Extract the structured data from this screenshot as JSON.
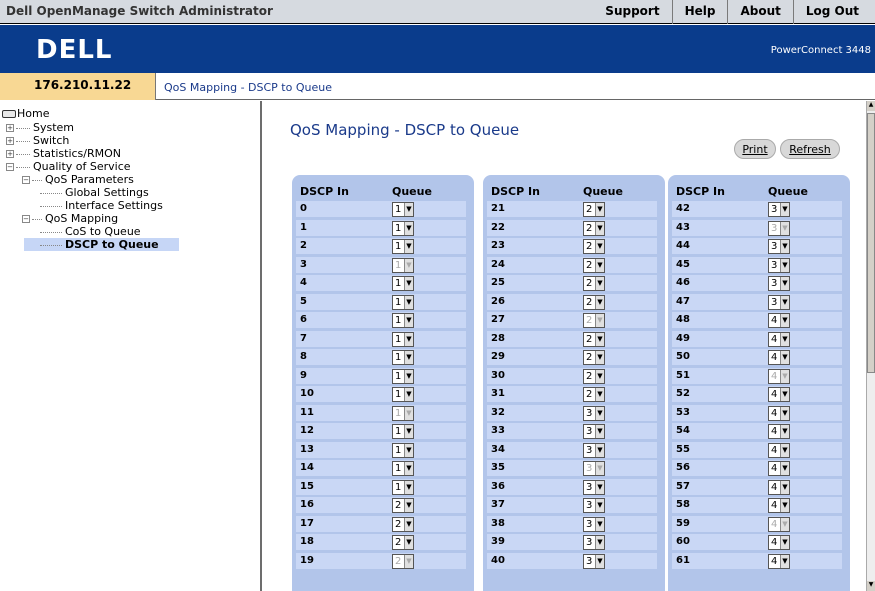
{
  "app_title": "Dell OpenManage Switch Administrator",
  "top_links": [
    "Support",
    "Help",
    "About",
    "Log Out"
  ],
  "logo_text": "DELL",
  "product": "PowerConnect 3448",
  "ip": "176.210.11.22",
  "breadcrumb": "QoS Mapping - DSCP to Queue",
  "tree": {
    "home": "Home",
    "system": "System",
    "switch": "Switch",
    "stats": "Statistics/RMON",
    "qos": "Quality of Service",
    "qos_params": "QoS Parameters",
    "global": "Global Settings",
    "iface": "Interface Settings",
    "qos_mapping": "QoS Mapping",
    "cos": "CoS to Queue",
    "dscp": "DSCP to Queue"
  },
  "page_title": "QoS Mapping - DSCP to Queue",
  "buttons": {
    "print": "Print",
    "refresh": "Refresh"
  },
  "table": {
    "header_dscp": "DSCP In",
    "header_queue": "Queue",
    "columns": [
      {
        "rows": [
          {
            "dscp": "0",
            "queue": "1",
            "disabled": false
          },
          {
            "dscp": "1",
            "queue": "1",
            "disabled": false
          },
          {
            "dscp": "2",
            "queue": "1",
            "disabled": false
          },
          {
            "dscp": "3",
            "queue": "1",
            "disabled": true
          },
          {
            "dscp": "4",
            "queue": "1",
            "disabled": false
          },
          {
            "dscp": "5",
            "queue": "1",
            "disabled": false
          },
          {
            "dscp": "6",
            "queue": "1",
            "disabled": false
          },
          {
            "dscp": "7",
            "queue": "1",
            "disabled": false
          },
          {
            "dscp": "8",
            "queue": "1",
            "disabled": false
          },
          {
            "dscp": "9",
            "queue": "1",
            "disabled": false
          },
          {
            "dscp": "10",
            "queue": "1",
            "disabled": false
          },
          {
            "dscp": "11",
            "queue": "1",
            "disabled": true
          },
          {
            "dscp": "12",
            "queue": "1",
            "disabled": false
          },
          {
            "dscp": "13",
            "queue": "1",
            "disabled": false
          },
          {
            "dscp": "14",
            "queue": "1",
            "disabled": false
          },
          {
            "dscp": "15",
            "queue": "1",
            "disabled": false
          },
          {
            "dscp": "16",
            "queue": "2",
            "disabled": false
          },
          {
            "dscp": "17",
            "queue": "2",
            "disabled": false
          },
          {
            "dscp": "18",
            "queue": "2",
            "disabled": false
          },
          {
            "dscp": "19",
            "queue": "2",
            "disabled": true
          }
        ]
      },
      {
        "rows": [
          {
            "dscp": "21",
            "queue": "2",
            "disabled": false
          },
          {
            "dscp": "22",
            "queue": "2",
            "disabled": false
          },
          {
            "dscp": "23",
            "queue": "2",
            "disabled": false
          },
          {
            "dscp": "24",
            "queue": "2",
            "disabled": false
          },
          {
            "dscp": "25",
            "queue": "2",
            "disabled": false
          },
          {
            "dscp": "26",
            "queue": "2",
            "disabled": false
          },
          {
            "dscp": "27",
            "queue": "2",
            "disabled": true
          },
          {
            "dscp": "28",
            "queue": "2",
            "disabled": false
          },
          {
            "dscp": "29",
            "queue": "2",
            "disabled": false
          },
          {
            "dscp": "30",
            "queue": "2",
            "disabled": false
          },
          {
            "dscp": "31",
            "queue": "2",
            "disabled": false
          },
          {
            "dscp": "32",
            "queue": "3",
            "disabled": false
          },
          {
            "dscp": "33",
            "queue": "3",
            "disabled": false
          },
          {
            "dscp": "34",
            "queue": "3",
            "disabled": false
          },
          {
            "dscp": "35",
            "queue": "3",
            "disabled": true
          },
          {
            "dscp": "36",
            "queue": "3",
            "disabled": false
          },
          {
            "dscp": "37",
            "queue": "3",
            "disabled": false
          },
          {
            "dscp": "38",
            "queue": "3",
            "disabled": false
          },
          {
            "dscp": "39",
            "queue": "3",
            "disabled": false
          },
          {
            "dscp": "40",
            "queue": "3",
            "disabled": false
          }
        ]
      },
      {
        "rows": [
          {
            "dscp": "42",
            "queue": "3",
            "disabled": false
          },
          {
            "dscp": "43",
            "queue": "3",
            "disabled": true
          },
          {
            "dscp": "44",
            "queue": "3",
            "disabled": false
          },
          {
            "dscp": "45",
            "queue": "3",
            "disabled": false
          },
          {
            "dscp": "46",
            "queue": "3",
            "disabled": false
          },
          {
            "dscp": "47",
            "queue": "3",
            "disabled": false
          },
          {
            "dscp": "48",
            "queue": "4",
            "disabled": false
          },
          {
            "dscp": "49",
            "queue": "4",
            "disabled": false
          },
          {
            "dscp": "50",
            "queue": "4",
            "disabled": false
          },
          {
            "dscp": "51",
            "queue": "4",
            "disabled": true
          },
          {
            "dscp": "52",
            "queue": "4",
            "disabled": false
          },
          {
            "dscp": "53",
            "queue": "4",
            "disabled": false
          },
          {
            "dscp": "54",
            "queue": "4",
            "disabled": false
          },
          {
            "dscp": "55",
            "queue": "4",
            "disabled": false
          },
          {
            "dscp": "56",
            "queue": "4",
            "disabled": false
          },
          {
            "dscp": "57",
            "queue": "4",
            "disabled": false
          },
          {
            "dscp": "58",
            "queue": "4",
            "disabled": false
          },
          {
            "dscp": "59",
            "queue": "4",
            "disabled": true
          },
          {
            "dscp": "60",
            "queue": "4",
            "disabled": false
          },
          {
            "dscp": "61",
            "queue": "4",
            "disabled": false
          }
        ]
      }
    ]
  }
}
